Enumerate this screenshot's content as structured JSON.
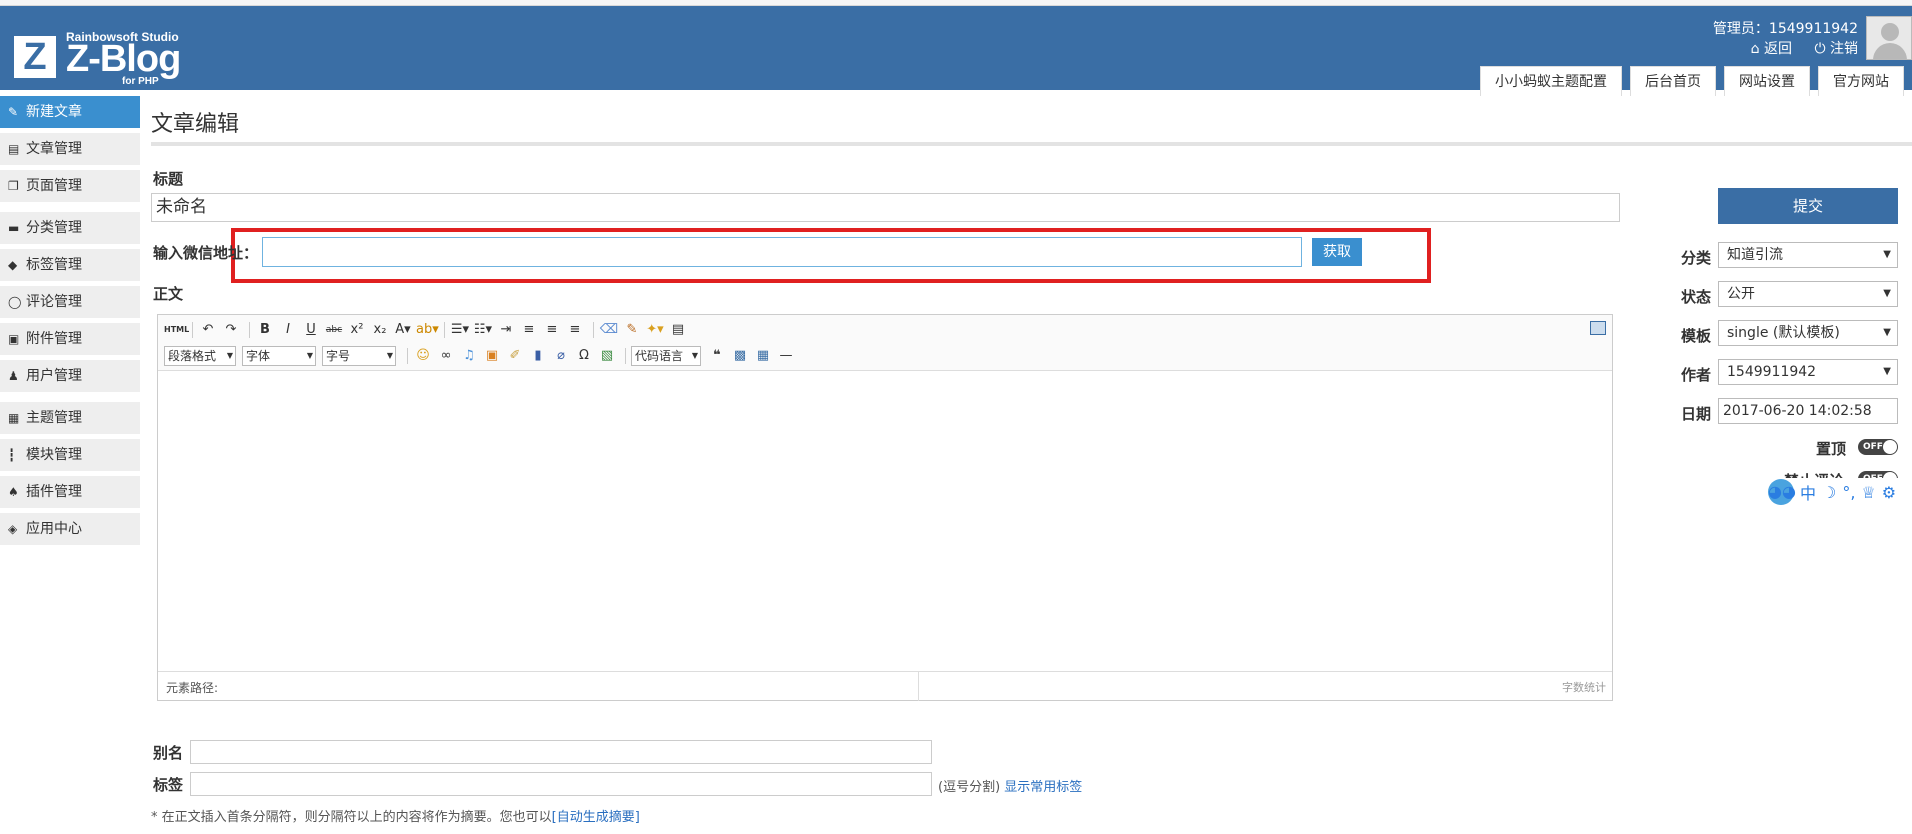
{
  "header": {
    "logo_letter": "Z",
    "logo_studio": "Rainbowsoft Studio",
    "logo_name": "Z-Blog",
    "logo_sub": "for PHP",
    "user_label": "管理员：1549911942",
    "back_link": "返回",
    "logout_link": "注销",
    "tabs": [
      "小小蚂蚁主题配置",
      "后台首页",
      "网站设置",
      "官方网站"
    ]
  },
  "sidebar": {
    "items": [
      {
        "label": "新建文章",
        "icon": "edit-icon"
      },
      {
        "label": "文章管理",
        "icon": "article-icon"
      },
      {
        "label": "页面管理",
        "icon": "page-icon"
      },
      {
        "label": "分类管理",
        "icon": "folder-icon"
      },
      {
        "label": "标签管理",
        "icon": "tag-icon"
      },
      {
        "label": "评论管理",
        "icon": "comment-icon"
      },
      {
        "label": "附件管理",
        "icon": "attachment-icon"
      },
      {
        "label": "用户管理",
        "icon": "user-icon"
      },
      {
        "label": "主题管理",
        "icon": "theme-icon"
      },
      {
        "label": "模块管理",
        "icon": "module-icon"
      },
      {
        "label": "插件管理",
        "icon": "plugin-icon"
      },
      {
        "label": "应用中心",
        "icon": "app-center-icon"
      }
    ]
  },
  "main": {
    "page_title": "文章编辑",
    "title_label": "标题",
    "title_value": "未命名",
    "wechat_label": "输入微信地址：",
    "wechat_value": "",
    "fetch_button": "获取",
    "body_label": "正文",
    "editor": {
      "html_button": "HTML",
      "paragraph_select": "段落格式",
      "font_select": "字体",
      "size_select": "字号",
      "code_select": "代码语言",
      "status_path": "元素路径:",
      "word_count": "字数统计"
    },
    "alias_label": "别名",
    "tags_label": "标签",
    "tags_hint": "(逗号分割)",
    "show_tags_link": "显示常用标签",
    "summary_note": "* 在正文插入首条分隔符，则分隔符以上的内容将作为摘要。您也可以",
    "auto_summary_link": "[自动生成摘要]"
  },
  "right_panel": {
    "submit_button": "提交",
    "category_label": "分类",
    "category_value": "知道引流",
    "status_label": "状态",
    "status_value": "公开",
    "template_label": "模板",
    "template_value": "single (默认模板)",
    "author_label": "作者",
    "author_value": "1549911942",
    "date_label": "日期",
    "date_value": "2017-06-20 14:02:58",
    "top_label": "置顶",
    "top_toggle": "OFF",
    "disable_comment_label": "禁止评论",
    "disable_comment_toggle": "OFF"
  },
  "ime": {
    "mode": "中"
  },
  "colors": {
    "header_bg": "#3a6ea5",
    "active_blue": "#3a8fcf",
    "highlight_red": "#e02020"
  }
}
